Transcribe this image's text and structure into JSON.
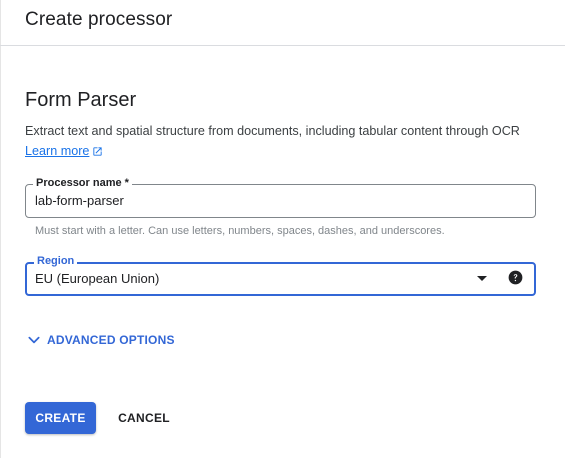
{
  "header": {
    "title": "Create processor"
  },
  "form": {
    "section_title": "Form Parser",
    "description": "Extract text and spatial structure from documents, including tabular content through OCR",
    "learn_more": "Learn more",
    "processor_name": {
      "label": "Processor name *",
      "value": "lab-form-parser",
      "helper": "Must start with a letter. Can use letters, numbers, spaces, dashes, and underscores."
    },
    "region": {
      "label": "Region",
      "value": "EU (European Union)"
    },
    "advanced_options": "ADVANCED OPTIONS"
  },
  "actions": {
    "create": "CREATE",
    "cancel": "CANCEL"
  },
  "colors": {
    "accent": "#3367d6",
    "link": "#1a73e8",
    "text": "#202124"
  },
  "icons": {
    "external_link": "external-link-icon",
    "dropdown": "dropdown-arrow-icon",
    "help": "help-circle-icon",
    "expand": "chevron-down-icon"
  }
}
